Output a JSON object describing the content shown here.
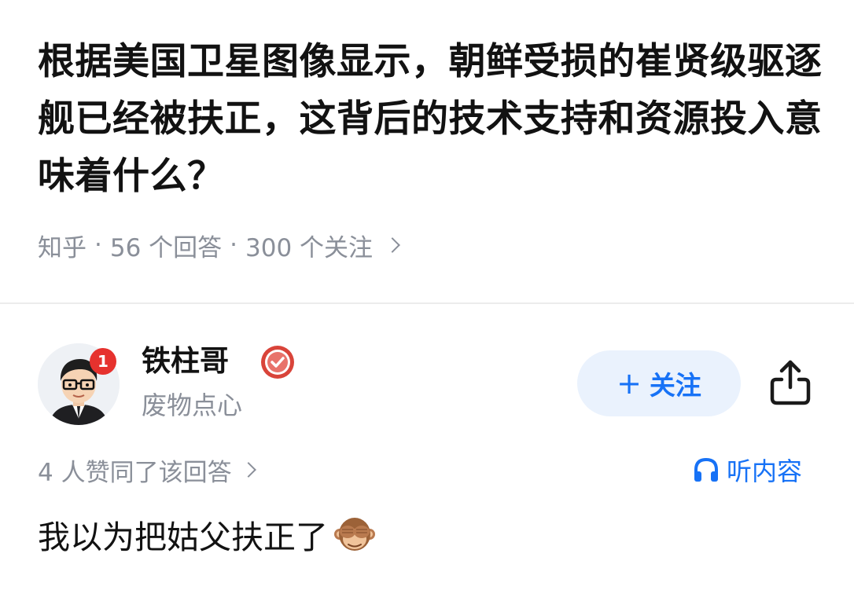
{
  "question": {
    "title": "根据美国卫星图像显示，朝鲜受损的崔贤级驱逐舰已经被扶正，这背后的技术支持和资源投入意味着什么？",
    "source": "知乎",
    "answers": "56 个回答",
    "followers": "300 个关注"
  },
  "author": {
    "name": "铁柱哥",
    "bio": "废物点心",
    "badge_count": "1",
    "verified_icon": "verified-badge-icon",
    "avatar_icon": "cartoon-man-with-glasses-avatar"
  },
  "actions": {
    "follow_plus": "+",
    "follow_label": "关注",
    "share_icon": "share-icon"
  },
  "answer": {
    "likes_text": "4 人赞同了该回答",
    "listen_label": "听内容",
    "text": "我以为把姑父扶正了",
    "emoji_icon": "see-no-evil-monkey-icon"
  },
  "colors": {
    "accent": "#1772f6",
    "follow_bg": "#eaf2fd",
    "muted": "#8a8f99",
    "badge_red": "#e6322e",
    "verified_red": "#d9443a"
  }
}
